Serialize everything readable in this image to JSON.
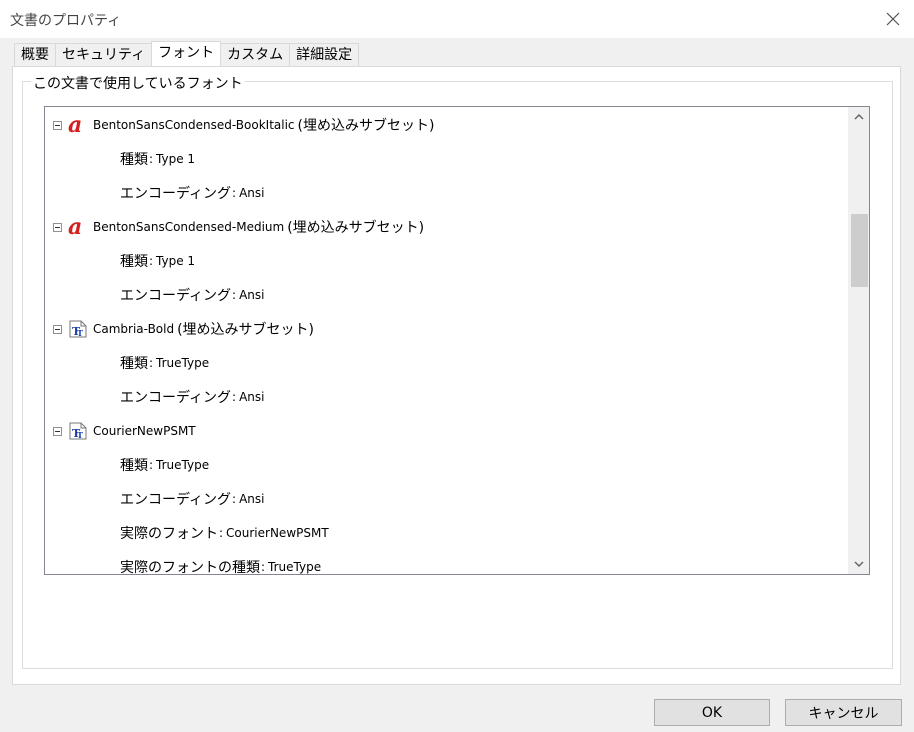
{
  "window": {
    "title": "文書のプロパティ"
  },
  "tabs": [
    {
      "label": "概要"
    },
    {
      "label": "セキュリティ"
    },
    {
      "label": "フォント"
    },
    {
      "label": "カスタム"
    },
    {
      "label": "詳細設定"
    }
  ],
  "fonts_group": {
    "label": "この文書で使用しているフォント"
  },
  "fonts": [
    {
      "name": "BentonSansCondensed-BookItalic",
      "note": "(埋め込みサブセット)",
      "icon": "type1-font-icon",
      "props": [
        {
          "label": "種類",
          "value": "Type 1"
        },
        {
          "label": "エンコーディング",
          "value": "Ansi"
        }
      ]
    },
    {
      "name": "BentonSansCondensed-Medium",
      "note": "(埋め込みサブセット)",
      "icon": "type1-font-icon",
      "props": [
        {
          "label": "種類",
          "value": "Type 1"
        },
        {
          "label": "エンコーディング",
          "value": "Ansi"
        }
      ]
    },
    {
      "name": "Cambria-Bold",
      "note": "(埋め込みサブセット)",
      "icon": "truetype-font-icon",
      "props": [
        {
          "label": "種類",
          "value": "TrueType"
        },
        {
          "label": "エンコーディング",
          "value": "Ansi"
        }
      ]
    },
    {
      "name": "CourierNewPSMT",
      "note": "",
      "icon": "truetype-font-icon",
      "props": [
        {
          "label": "種類",
          "value": "TrueType"
        },
        {
          "label": "エンコーディング",
          "value": "Ansi"
        },
        {
          "label": "実際のフォント",
          "value": "CourierNewPSMT"
        },
        {
          "label": "実際のフォントの種類",
          "value": "TrueType"
        }
      ]
    }
  ],
  "buttons": {
    "ok": "OK",
    "cancel": "キャンセル"
  },
  "colors": {
    "accent_type1": "#d42020",
    "accent_truetype": "#1a3fb0"
  }
}
